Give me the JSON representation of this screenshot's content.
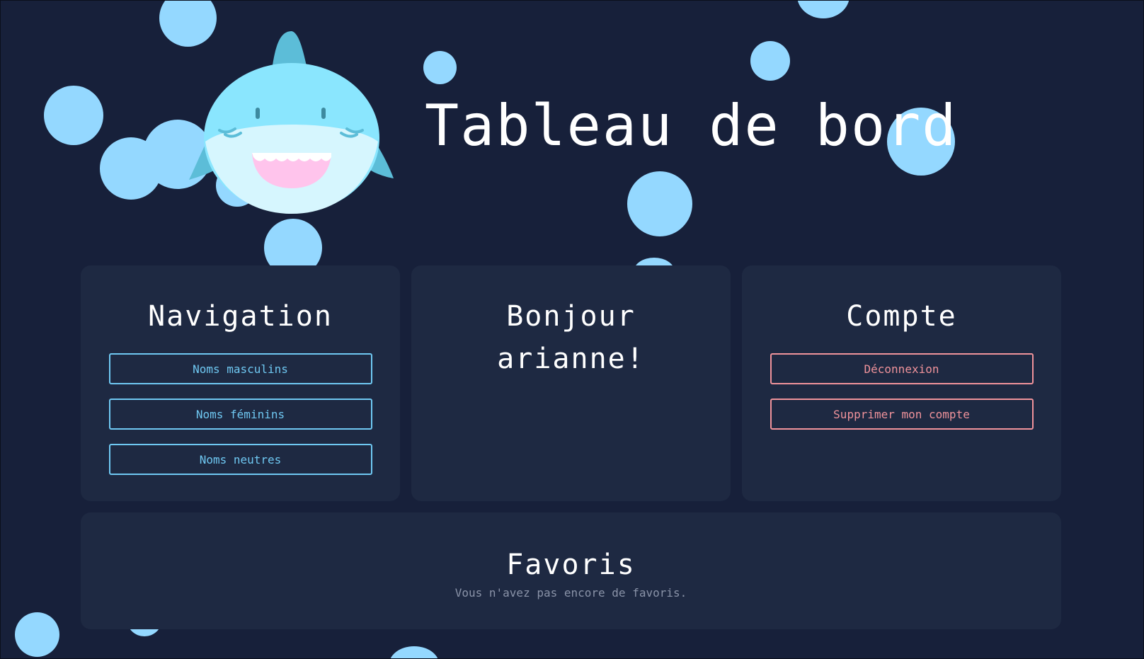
{
  "header": {
    "title": "Tableau de bord"
  },
  "navigation": {
    "title": "Navigation",
    "buttons": [
      "Noms masculins",
      "Noms féminins",
      "Noms neutres"
    ]
  },
  "greeting": {
    "line1": "Bonjour",
    "line2": "arianne!"
  },
  "account": {
    "title": "Compte",
    "logout_label": "Déconnexion",
    "delete_label": "Supprimer mon compte"
  },
  "favorites": {
    "title": "Favoris",
    "empty_message": "Vous n'avez pas encore de favoris."
  },
  "colors": {
    "background": "#17203a",
    "card": "#1e2942",
    "bubble": "#94d8ff",
    "accent_blue": "#6fc8f2",
    "accent_red": "#f0939b",
    "text_muted": "#8a93a8"
  },
  "icons": {
    "mascot": "shark-mascot-icon",
    "decoration": "bubble-icon"
  }
}
